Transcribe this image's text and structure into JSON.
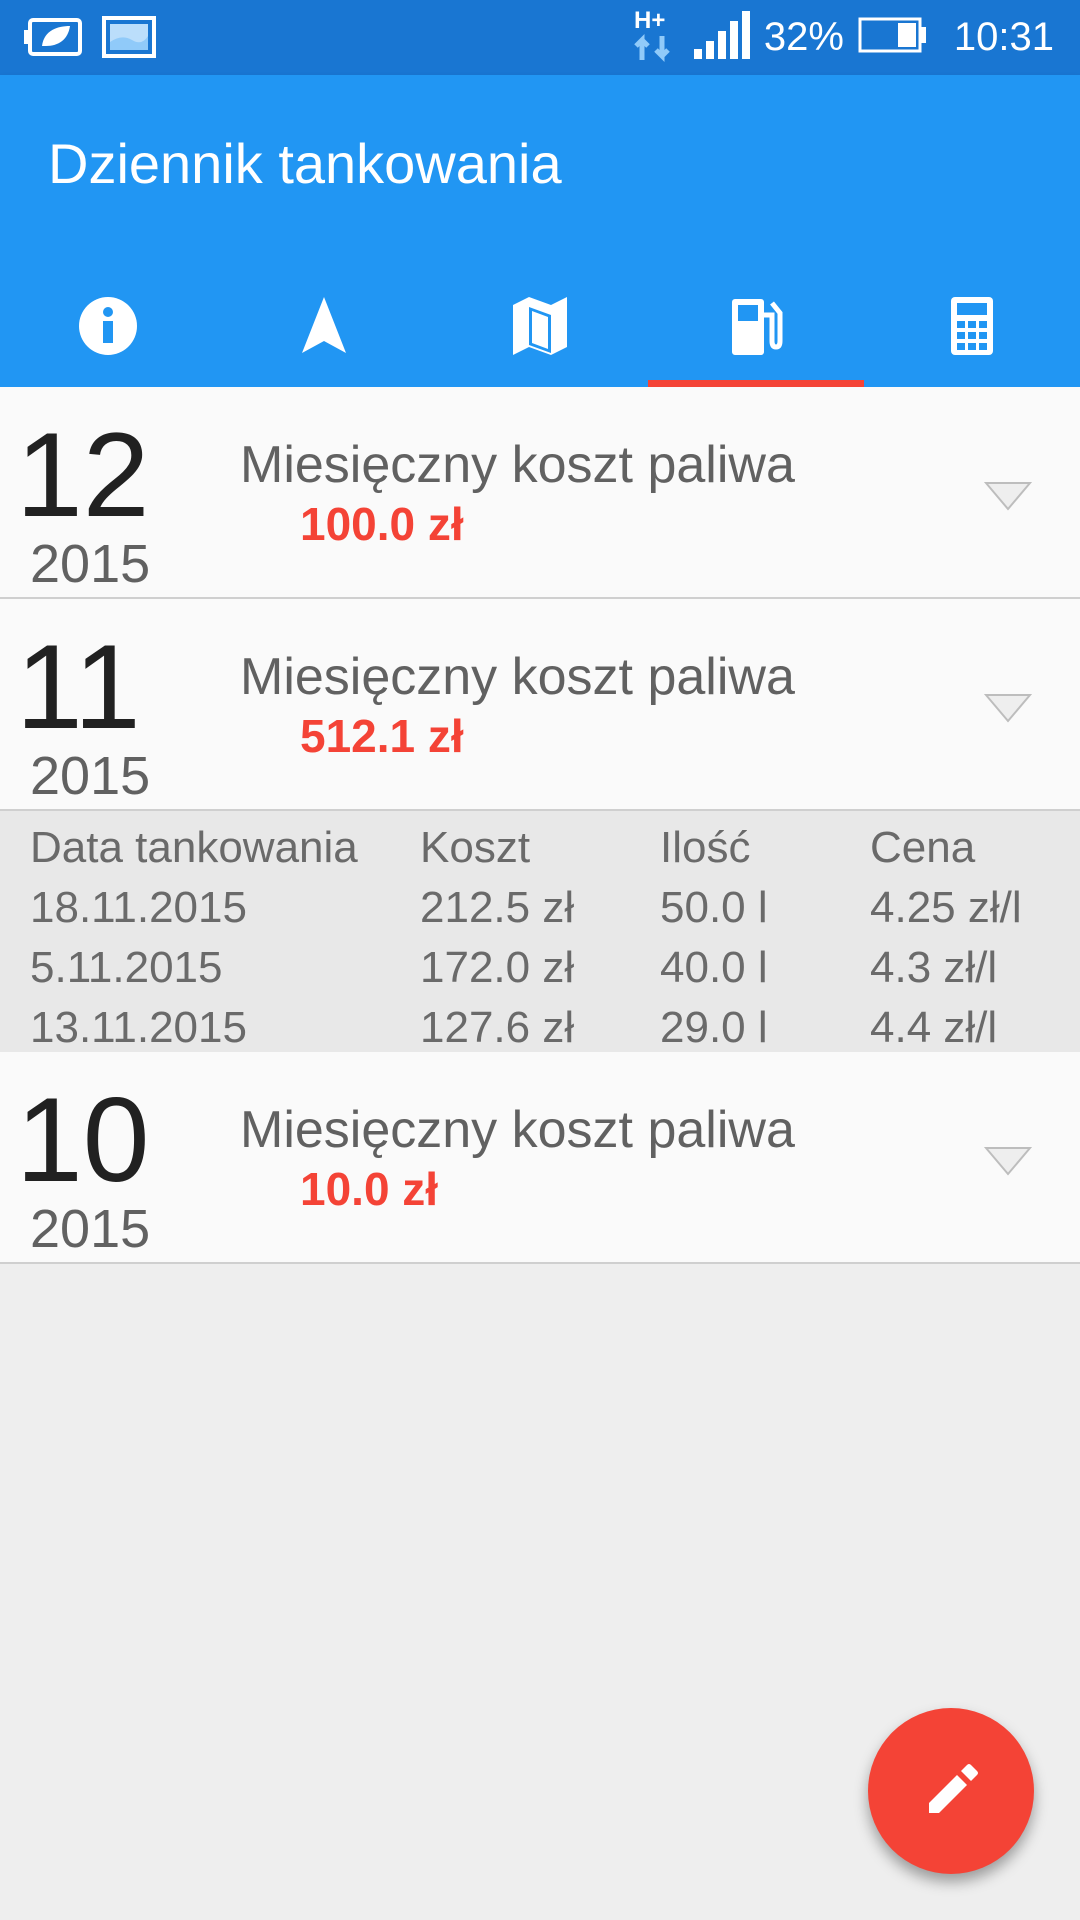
{
  "status_bar": {
    "network": "H+",
    "battery_percent": "32%",
    "time": "10:31",
    "icons": [
      "eco-battery-icon",
      "image-icon",
      "data-transfer-icon",
      "signal-icon",
      "battery-icon"
    ]
  },
  "app": {
    "title": "Dziennik tankowania",
    "primary_color": "#2196f3",
    "status_color": "#1976d2",
    "accent_color": "#f44336"
  },
  "tabs": [
    {
      "icon": "info-icon",
      "active": false
    },
    {
      "icon": "navigation-icon",
      "active": false
    },
    {
      "icon": "map-icon",
      "active": false
    },
    {
      "icon": "fuel-pump-icon",
      "active": true
    },
    {
      "icon": "calculator-icon",
      "active": false
    }
  ],
  "months": [
    {
      "month": "12",
      "year": "2015",
      "label": "Miesięczny koszt paliwa",
      "value": "100.0 zł",
      "expanded": false
    },
    {
      "month": "11",
      "year": "2015",
      "label": "Miesięczny koszt paliwa",
      "value": "512.1 zł",
      "expanded": true,
      "details": {
        "headers": [
          "Data tankowania",
          "Koszt",
          "Ilość",
          "Cena"
        ],
        "rows": [
          [
            "18.11.2015",
            "212.5 zł",
            "50.0 l",
            "4.25 zł/l"
          ],
          [
            "5.11.2015",
            "172.0 zł",
            "40.0 l",
            "4.3 zł/l"
          ],
          [
            "13.11.2015",
            "127.6 zł",
            "29.0 l",
            "4.4 zł/l"
          ]
        ]
      }
    },
    {
      "month": "10",
      "year": "2015",
      "label": "Miesięczny koszt paliwa",
      "value": "10.0 zł",
      "expanded": false
    }
  ],
  "fab": {
    "icon": "edit-pencil-icon"
  }
}
